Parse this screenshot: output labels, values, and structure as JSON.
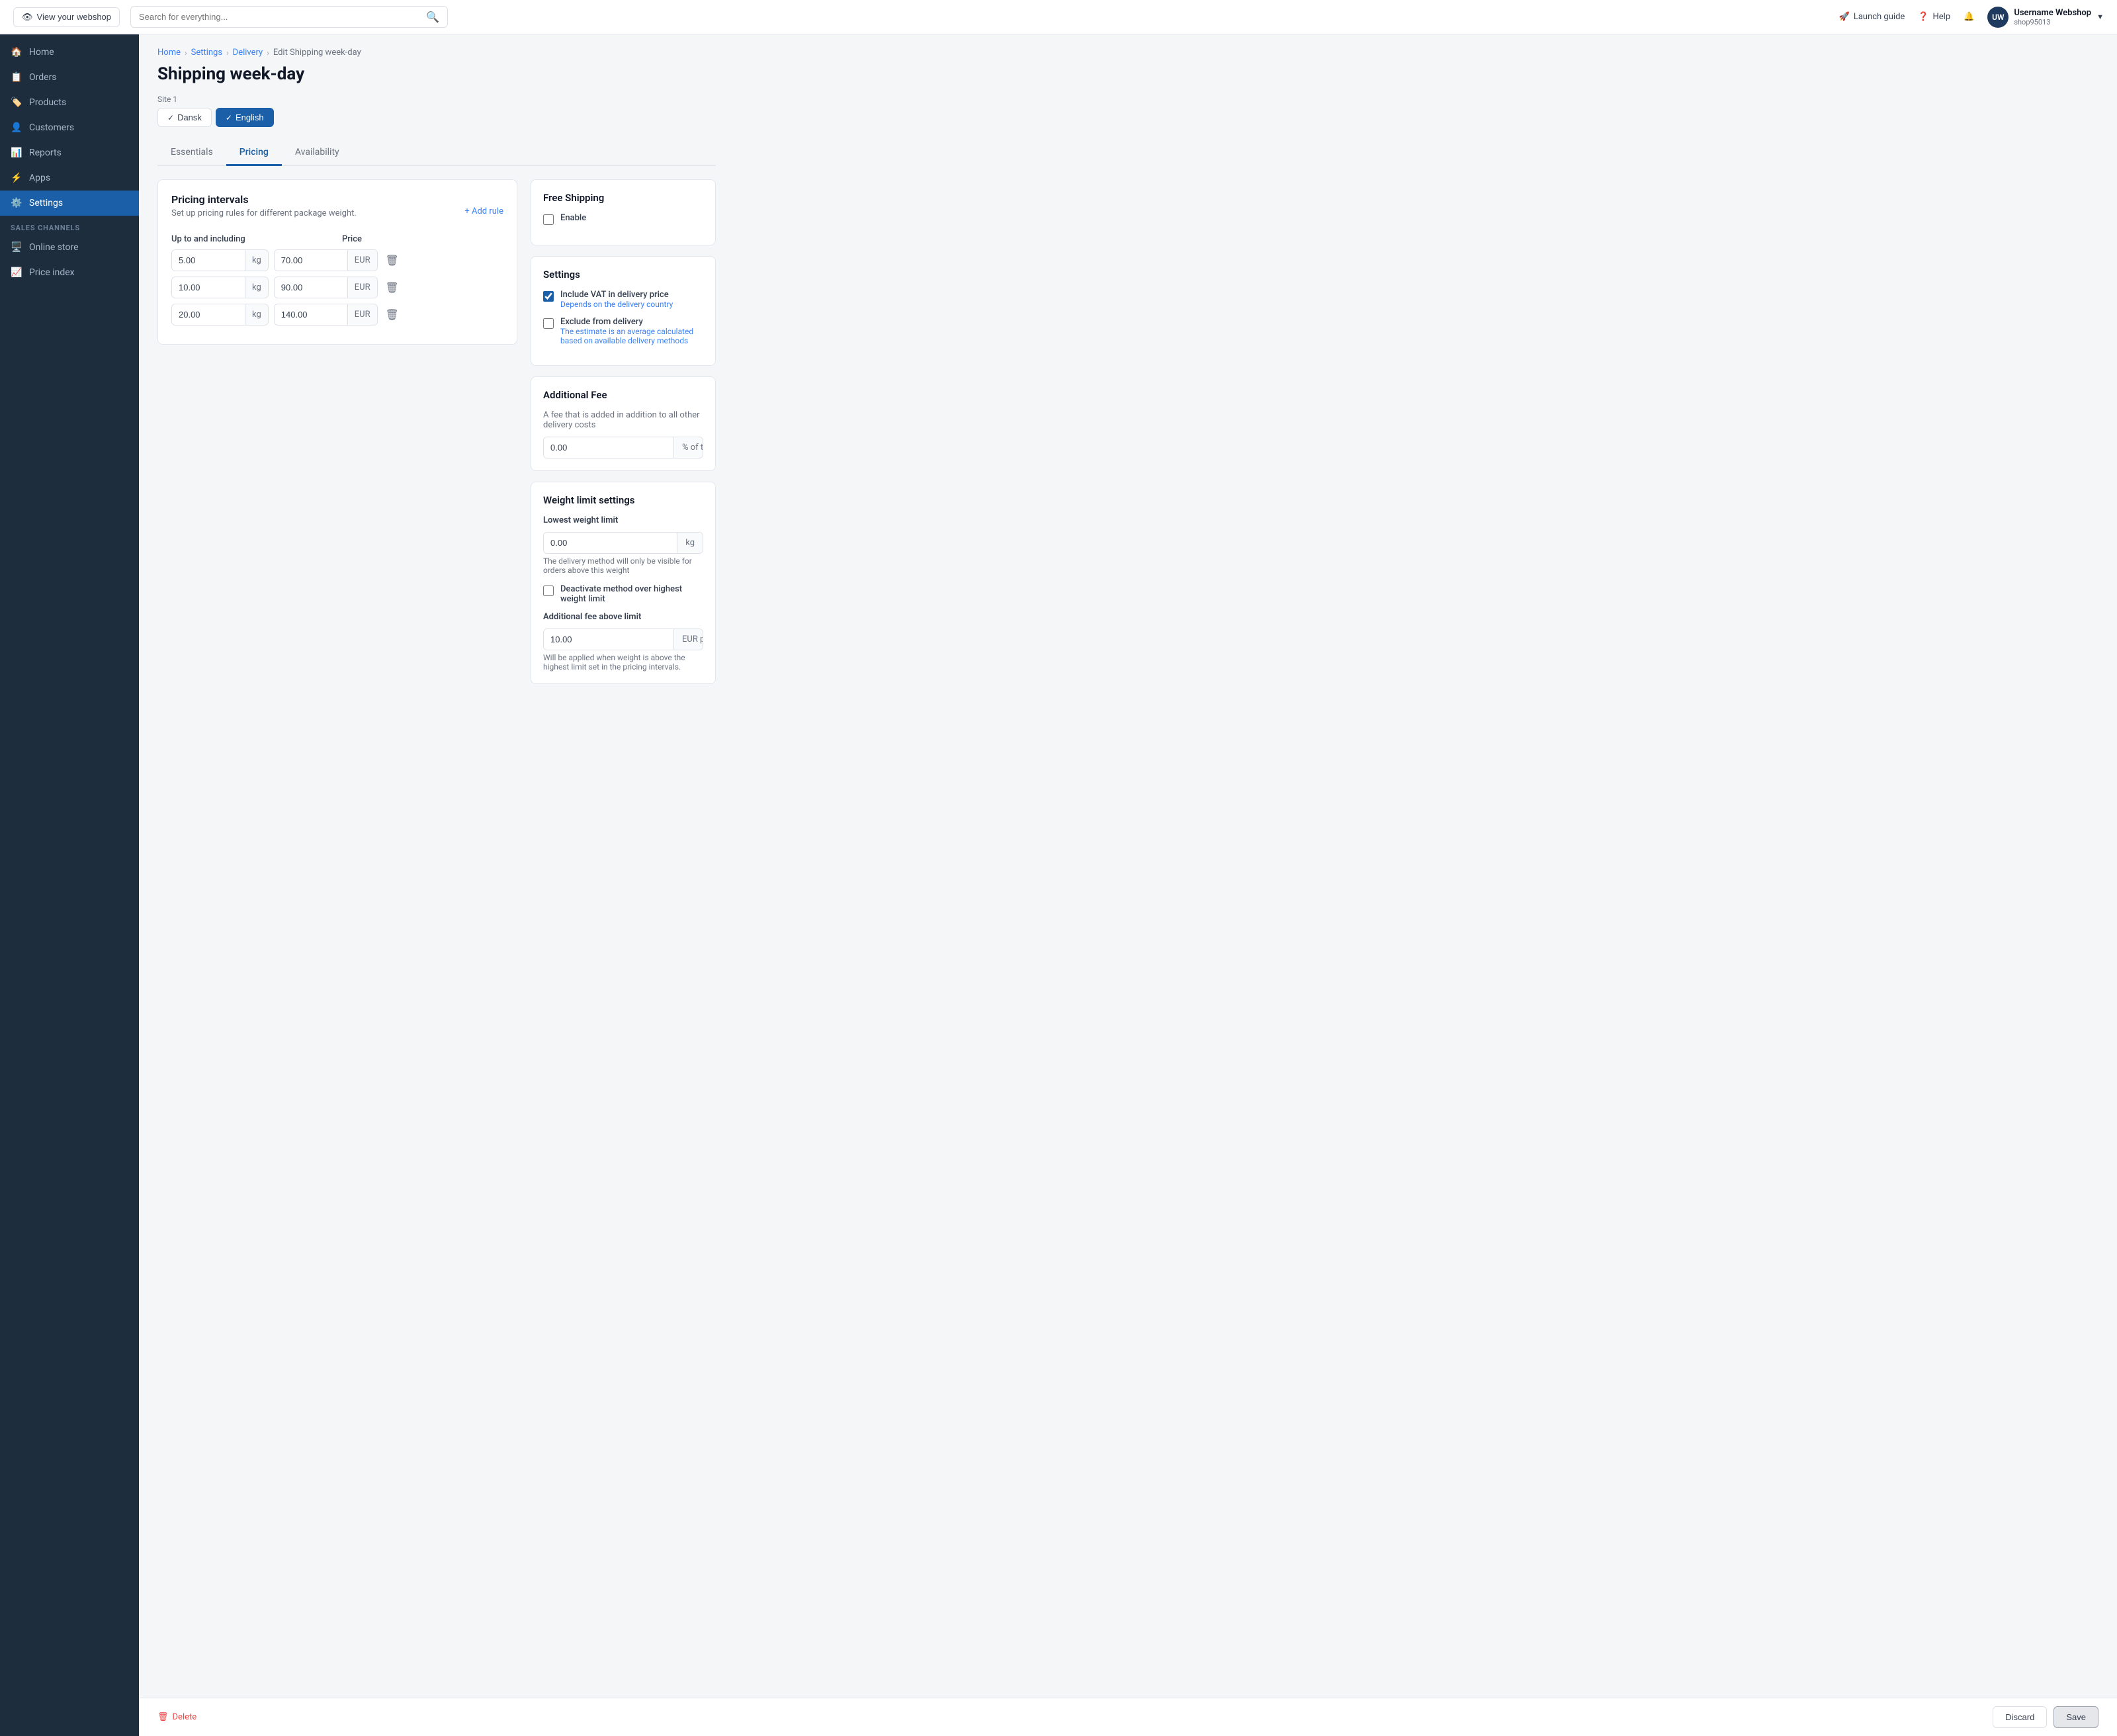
{
  "header": {
    "view_webshop_label": "View your webshop",
    "search_placeholder": "Search for everything...",
    "launch_guide_label": "Launch guide",
    "help_label": "Help",
    "user_initials": "UW",
    "user_name": "Username Webshop",
    "user_shop": "shop95013"
  },
  "sidebar": {
    "items": [
      {
        "id": "home",
        "label": "Home",
        "icon": "🏠"
      },
      {
        "id": "orders",
        "label": "Orders",
        "icon": "📋"
      },
      {
        "id": "products",
        "label": "Products",
        "icon": "🏷️"
      },
      {
        "id": "customers",
        "label": "Customers",
        "icon": "👤"
      },
      {
        "id": "reports",
        "label": "Reports",
        "icon": "📊"
      },
      {
        "id": "apps",
        "label": "Apps",
        "icon": "⚡"
      },
      {
        "id": "settings",
        "label": "Settings",
        "icon": "⚙️",
        "active": true
      }
    ],
    "sales_channels_title": "SALES CHANNELS",
    "channels": [
      {
        "id": "online-store",
        "label": "Online store",
        "icon": "🖥️"
      },
      {
        "id": "price-index",
        "label": "Price index",
        "icon": "📈"
      }
    ]
  },
  "breadcrumb": {
    "items": [
      "Home",
      "Settings",
      "Delivery",
      "Edit Shipping week-day"
    ]
  },
  "page": {
    "title": "Shipping week-day",
    "site_label": "Site 1",
    "lang_tabs": [
      {
        "id": "dansk",
        "label": "Dansk",
        "active": false
      },
      {
        "id": "english",
        "label": "English",
        "active": true
      }
    ],
    "tabs": [
      {
        "id": "essentials",
        "label": "Essentials",
        "active": false
      },
      {
        "id": "pricing",
        "label": "Pricing",
        "active": true
      },
      {
        "id": "availability",
        "label": "Availability",
        "active": false
      }
    ]
  },
  "pricing_intervals": {
    "title": "Pricing intervals",
    "description": "Set up pricing rules for different package weight.",
    "add_rule_label": "+ Add rule",
    "col_weight": "Up to and including",
    "col_price": "Price",
    "rows": [
      {
        "weight": "5.00",
        "weight_unit": "kg",
        "price": "70.00",
        "price_unit": "EUR"
      },
      {
        "weight": "10.00",
        "weight_unit": "kg",
        "price": "90.00",
        "price_unit": "EUR"
      },
      {
        "weight": "20.00",
        "weight_unit": "kg",
        "price": "140.00",
        "price_unit": "EUR"
      }
    ]
  },
  "free_shipping": {
    "title": "Free Shipping",
    "enable_label": "Enable",
    "enabled": false
  },
  "settings_panel": {
    "title": "Settings",
    "vat_label": "Include VAT in delivery price",
    "vat_sub": "Depends on the delivery country",
    "vat_checked": true,
    "exclude_label": "Exclude from delivery",
    "exclude_sub": "The estimate is an average calculated based on available delivery methods",
    "exclude_checked": false
  },
  "additional_fee": {
    "title": "Additional Fee",
    "description": "A fee that is added in addition to all other delivery costs",
    "value": "0.00",
    "unit": "% of total order"
  },
  "weight_limit": {
    "title": "Weight limit settings",
    "lowest_label": "Lowest weight limit",
    "lowest_value": "0.00",
    "lowest_unit": "kg",
    "lowest_hint": "The delivery method will only be visible for orders above this weight",
    "deactivate_label": "Deactivate method over highest weight limit",
    "deactivate_checked": false,
    "additional_fee_label": "Additional fee above limit",
    "additional_fee_value": "10.00",
    "additional_fee_unit": "EUR per kg",
    "additional_fee_hint": "Will be applied when weight is above the highest limit set in the pricing intervals."
  },
  "footer": {
    "delete_label": "Delete",
    "discard_label": "Discard",
    "save_label": "Save"
  }
}
